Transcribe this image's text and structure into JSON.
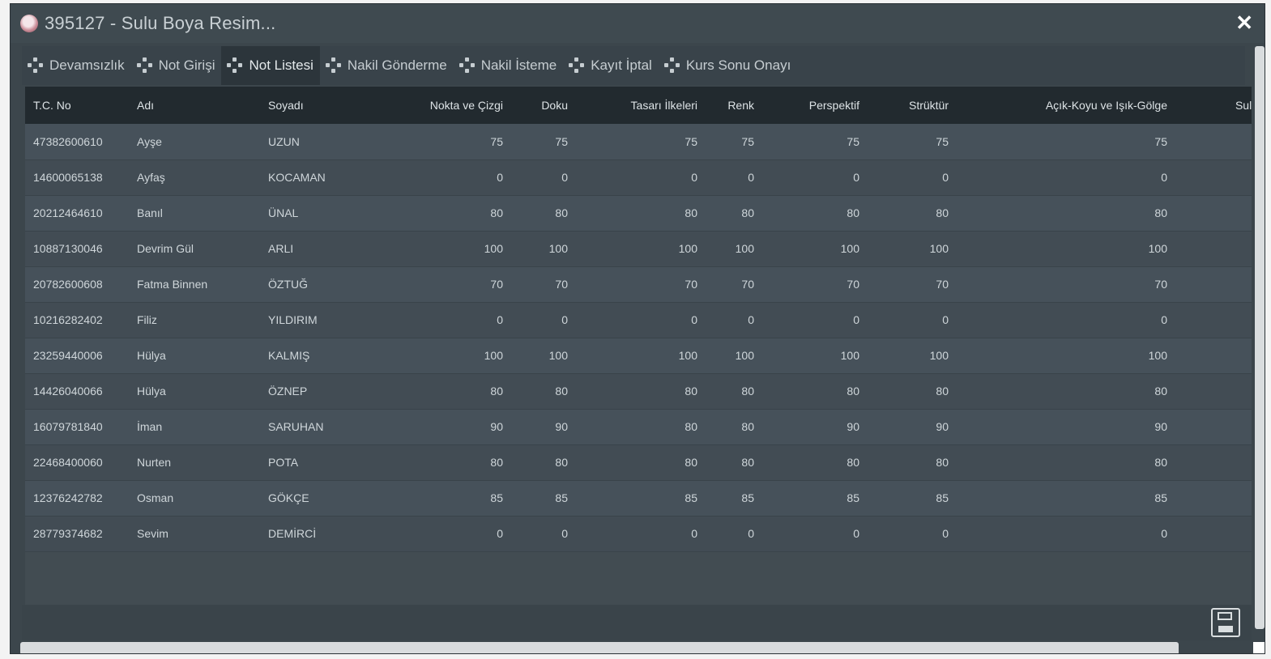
{
  "window": {
    "title": "395127 - Sulu Boya Resim..."
  },
  "tabs": [
    {
      "label": "Devamsızlık"
    },
    {
      "label": "Not Girişi"
    },
    {
      "label": "Not Listesi"
    },
    {
      "label": "Nakil Gönderme"
    },
    {
      "label": "Nakil İsteme"
    },
    {
      "label": "Kayıt İptal"
    },
    {
      "label": "Kurs Sonu Onayı"
    }
  ],
  "active_tab_index": 2,
  "table": {
    "columns": [
      "T.C. No",
      "Adı",
      "Soyadı",
      "Nokta ve Çizgi",
      "Doku",
      "Tasarı İlkeleri",
      "Renk",
      "Perspektif",
      "Strüktür",
      "Açık-Koyu ve Işık-Gölge",
      "Sulu Boy"
    ],
    "rows": [
      [
        "47382600610",
        "Ayşe",
        "UZUN",
        "75",
        "75",
        "75",
        "75",
        "75",
        "75",
        "75"
      ],
      [
        "14600065138",
        "Ayfaş",
        "KOCAMAN",
        "0",
        "0",
        "0",
        "0",
        "0",
        "0",
        "0"
      ],
      [
        "20212464610",
        "Banıl",
        "ÜNAL",
        "80",
        "80",
        "80",
        "80",
        "80",
        "80",
        "80"
      ],
      [
        "10887130046",
        "Devrim Gül",
        "ARLI",
        "100",
        "100",
        "100",
        "100",
        "100",
        "100",
        "100"
      ],
      [
        "20782600608",
        "Fatma Binnen",
        "ÖZTUĞ",
        "70",
        "70",
        "70",
        "70",
        "70",
        "70",
        "70"
      ],
      [
        "10216282402",
        "Filiz",
        "YILDIRIM",
        "0",
        "0",
        "0",
        "0",
        "0",
        "0",
        "0"
      ],
      [
        "23259440006",
        "Hülya",
        "KALMIŞ",
        "100",
        "100",
        "100",
        "100",
        "100",
        "100",
        "100"
      ],
      [
        "14426040066",
        "Hülya",
        "ÖZNEP",
        "80",
        "80",
        "80",
        "80",
        "80",
        "80",
        "80"
      ],
      [
        "16079781840",
        "İman",
        "SARUHAN",
        "90",
        "90",
        "80",
        "80",
        "90",
        "90",
        "90"
      ],
      [
        "22468400060",
        "Nurten",
        "POTA",
        "80",
        "80",
        "80",
        "80",
        "80",
        "80",
        "80"
      ],
      [
        "12376242782",
        "Osman",
        "GÖKÇE",
        "85",
        "85",
        "85",
        "85",
        "85",
        "85",
        "85"
      ],
      [
        "28779374682",
        "Sevim",
        "DEMİRCİ",
        "0",
        "0",
        "0",
        "0",
        "0",
        "0",
        "0"
      ]
    ]
  },
  "icons": {
    "app": "app-logo-icon",
    "close": "close-icon",
    "tab": "tab-arrows-icon",
    "save": "save-icon"
  },
  "colors": {
    "window_bg": "#3c464c",
    "header_bg": "#222a2f",
    "active_tab_bg": "#2c353b",
    "text": "#cfd6da"
  }
}
